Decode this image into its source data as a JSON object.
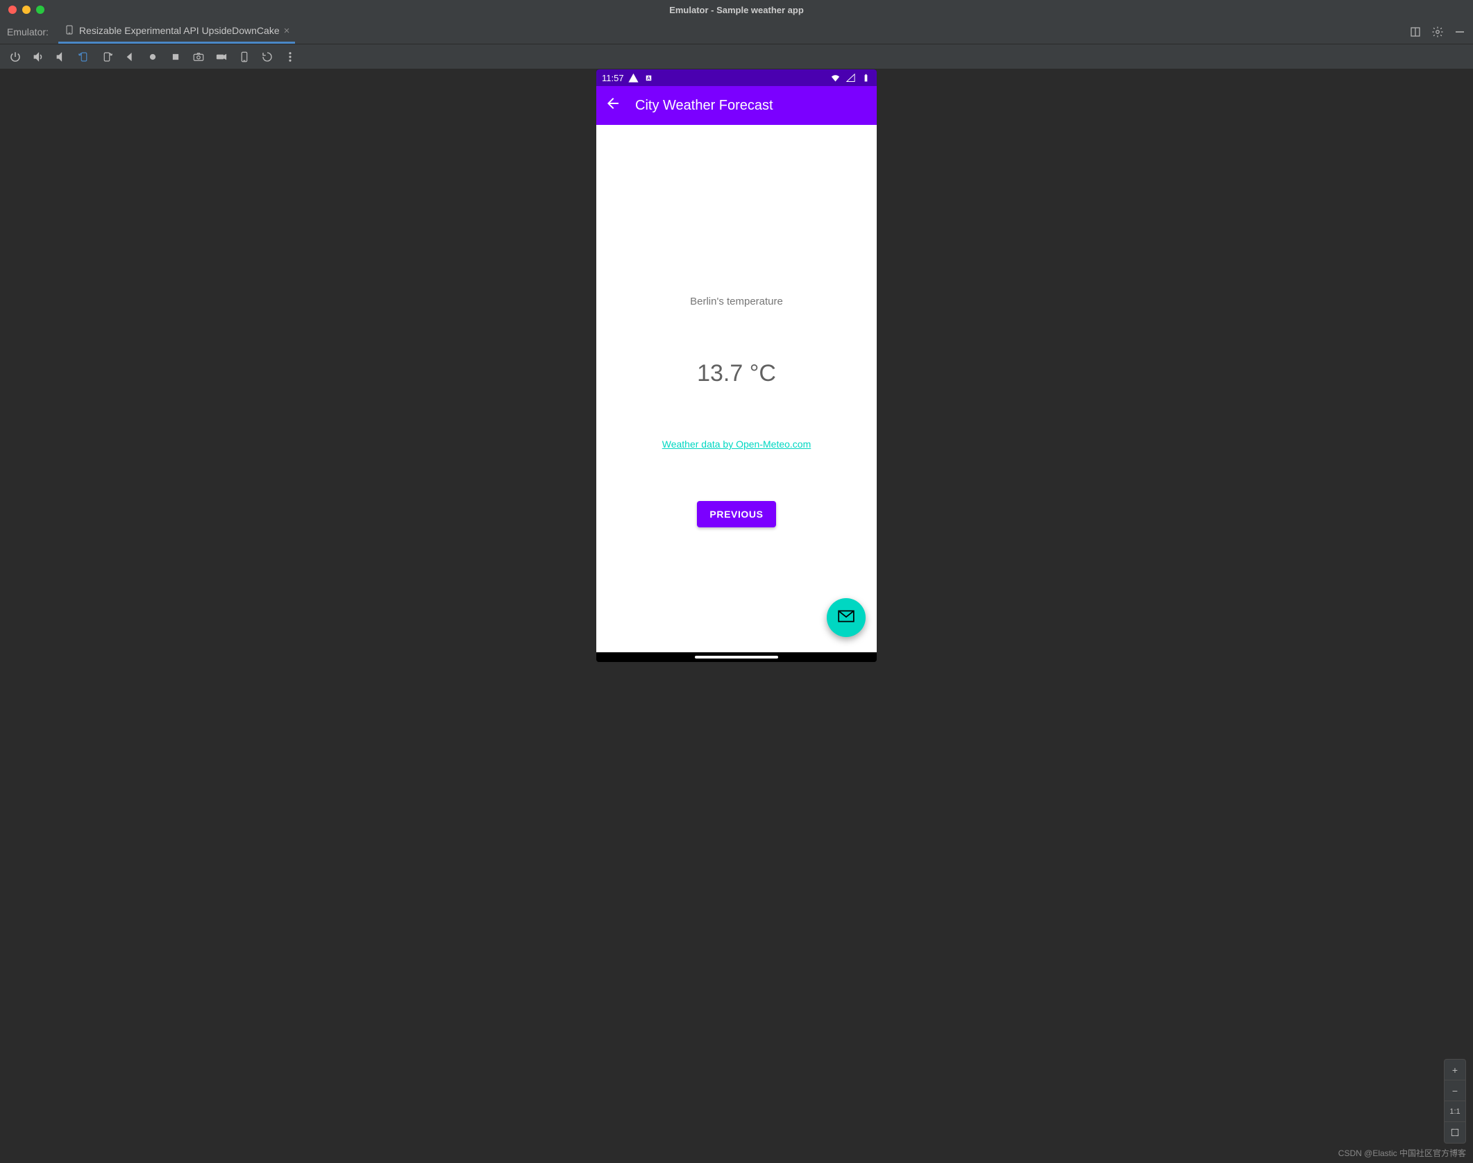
{
  "mac_title": "Emulator - Sample weather app",
  "ide": {
    "tabbar_label": "Emulator:",
    "tab_name": "Resizable Experimental API UpsideDownCake"
  },
  "zoom": {
    "in": "+",
    "out": "−",
    "one": "1:1"
  },
  "android": {
    "status_time": "11:57",
    "appbar_title": "City Weather Forecast",
    "temp_label": "Berlin's temperature",
    "temp_value": "13.7 °C",
    "weather_link": "Weather data by Open-Meteo.com",
    "prev_btn": "PREVIOUS"
  },
  "watermark": "CSDN @Elastic 中国社区官方博客"
}
